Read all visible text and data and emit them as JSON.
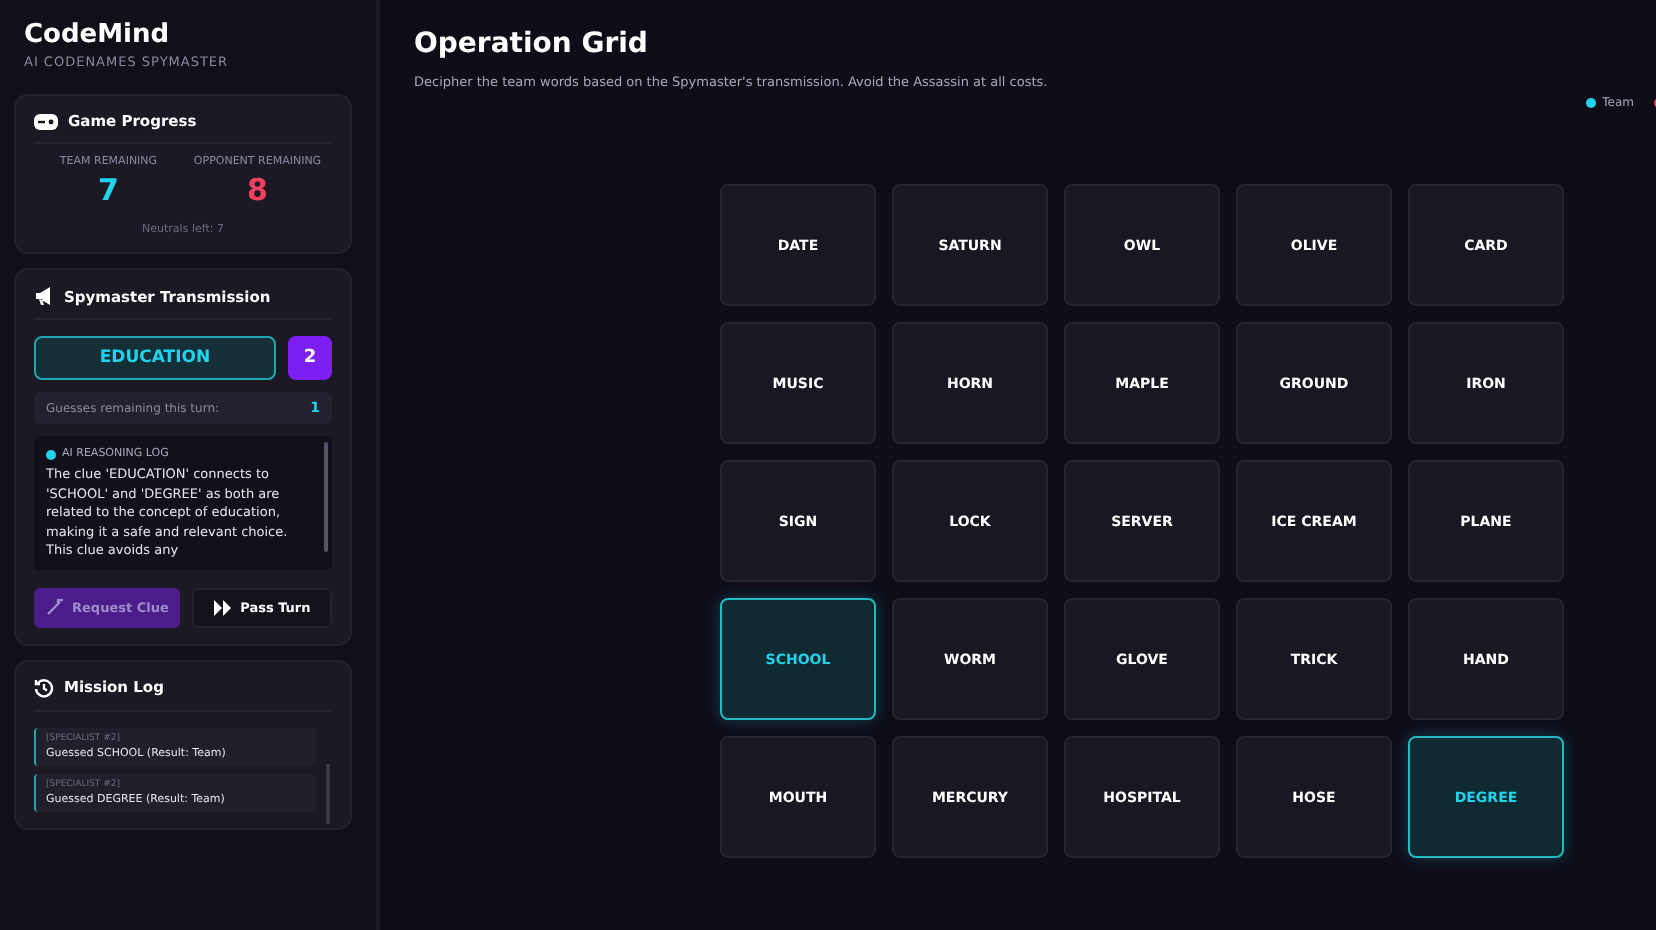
{
  "brand": {
    "title": "CodeMind",
    "subtitle": "AI CODENAMES SPYMASTER"
  },
  "progress": {
    "title": "Game Progress",
    "team_label": "TEAM REMAINING",
    "team_value": "7",
    "opponent_label": "OPPONENT REMAINING",
    "opponent_value": "8",
    "neutrals": "Neutrals left: 7"
  },
  "transmission": {
    "title": "Spymaster Transmission",
    "clue": "EDUCATION",
    "count": "2",
    "guesses_label": "Guesses remaining this turn:",
    "guesses_value": "1",
    "log_title": "AI REASONING LOG",
    "log_text": "The clue 'EDUCATION' connects to 'SCHOOL' and 'DEGREE' as both are related to the concept of education, making it a safe and relevant choice. This clue avoids any",
    "buttons": [
      {
        "label": "Request Clue",
        "kind": "primary",
        "disabled": true
      },
      {
        "label": "Pass Turn",
        "kind": "secondary",
        "disabled": false
      }
    ]
  },
  "mission_log": {
    "title": "Mission Log",
    "entries": [
      {
        "who": "[SPECIALIST #2]",
        "text": "Guessed SCHOOL (Result: Team)"
      },
      {
        "who": "[SPECIALIST #2]",
        "text": "Guessed DEGREE (Result: Team)"
      }
    ]
  },
  "header": {
    "title": "Operation Grid",
    "subtitle": "Decipher the team words based on the Spymaster's transmission. Avoid the Assassin at all costs.",
    "legend": [
      {
        "label": "Team",
        "color": "#22d3ee"
      },
      {
        "color": "#f43f5e"
      }
    ]
  },
  "cards": [
    {
      "word": "DATE",
      "revealed": false
    },
    {
      "word": "SATURN",
      "revealed": false
    },
    {
      "word": "OWL",
      "revealed": false
    },
    {
      "word": "OLIVE",
      "revealed": false
    },
    {
      "word": "CARD",
      "revealed": false
    },
    {
      "word": "MUSIC",
      "revealed": false
    },
    {
      "word": "HORN",
      "revealed": false
    },
    {
      "word": "MAPLE",
      "revealed": false
    },
    {
      "word": "GROUND",
      "revealed": false
    },
    {
      "word": "IRON",
      "revealed": false
    },
    {
      "word": "SIGN",
      "revealed": false
    },
    {
      "word": "LOCK",
      "revealed": false
    },
    {
      "word": "SERVER",
      "revealed": false
    },
    {
      "word": "ICE CREAM",
      "revealed": false
    },
    {
      "word": "PLANE",
      "revealed": false
    },
    {
      "word": "SCHOOL",
      "revealed": true
    },
    {
      "word": "WORM",
      "revealed": false
    },
    {
      "word": "GLOVE",
      "revealed": false
    },
    {
      "word": "TRICK",
      "revealed": false
    },
    {
      "word": "HAND",
      "revealed": false
    },
    {
      "word": "MOUTH",
      "revealed": false
    },
    {
      "word": "MERCURY",
      "revealed": false
    },
    {
      "word": "HOSPITAL",
      "revealed": false
    },
    {
      "word": "HOSE",
      "revealed": false
    },
    {
      "word": "DEGREE",
      "revealed": true
    }
  ]
}
